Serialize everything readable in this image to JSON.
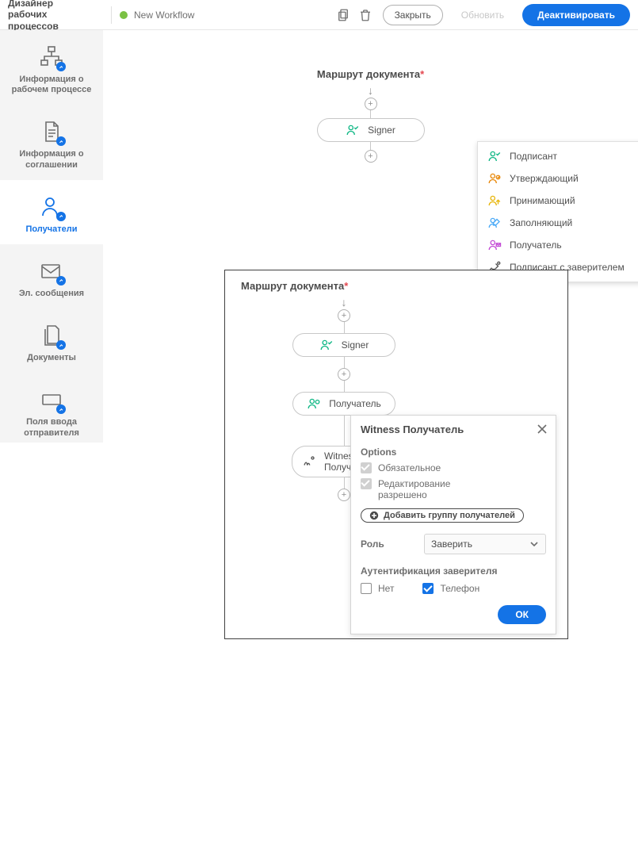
{
  "app": {
    "title": "Дизайнер рабочих процессов"
  },
  "topbar": {
    "workflow_name": "New Workflow",
    "close": "Закрыть",
    "refresh": "Обновить",
    "deactivate": "Деактивировать"
  },
  "sidebar": {
    "items": [
      {
        "label": "Информация о рабочем процессе"
      },
      {
        "label": "Информация о соглашении"
      },
      {
        "label": "Получатели"
      },
      {
        "label": "Эл. сообщения"
      },
      {
        "label": "Документы"
      },
      {
        "label": "Поля ввода отправителя"
      }
    ]
  },
  "flow1": {
    "title": "Маршрут документа",
    "node_signer": "Signer",
    "menu": [
      "Подписант",
      "Утверждающий",
      "Принимающий",
      "Заполняющий",
      "Получатель",
      "Подписант с заверителем"
    ]
  },
  "flow2": {
    "title": "Маршрут документа",
    "nodes": {
      "signer": "Signer",
      "recipient": "Получатель",
      "witness": "Witness Получат..."
    }
  },
  "props": {
    "title": "Witness Получатель",
    "options_header": "Options",
    "opt_required": "Обязательное",
    "opt_editable": "Редактирование разрешено",
    "add_group": "Добавить группу получателей",
    "role_label": "Роль",
    "role_value": "Заверить",
    "auth_header": "Аутентификация заверителя",
    "auth_none": "Нет",
    "auth_phone": "Телефон",
    "ok": "ОК"
  }
}
